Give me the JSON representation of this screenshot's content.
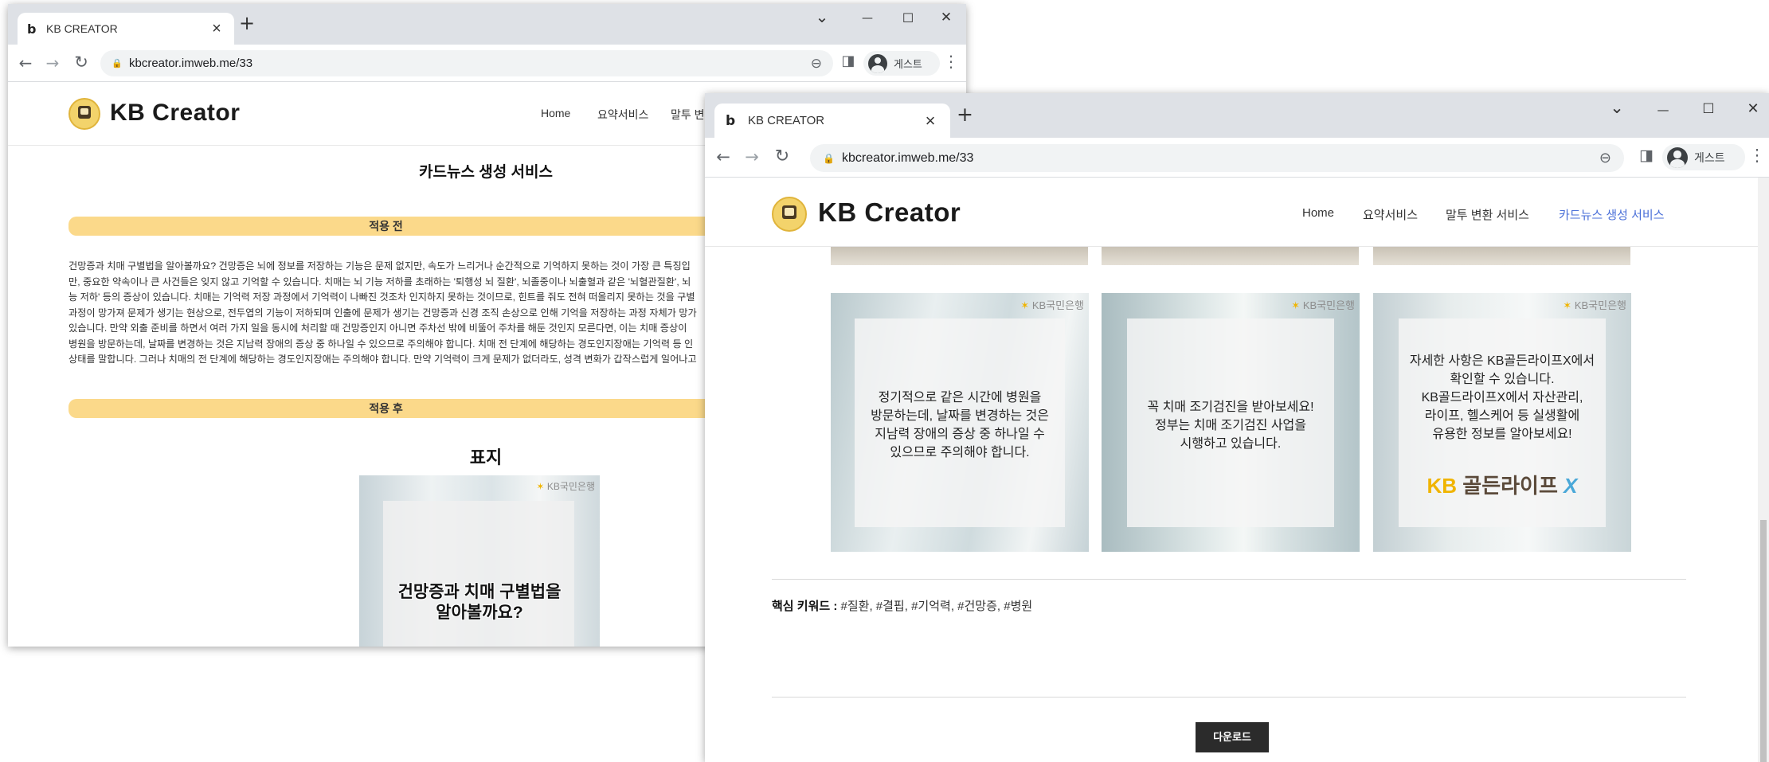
{
  "back_window": {
    "tab_title": "KB CREATOR",
    "favicon": "b",
    "url": "kbcreator.imweb.me/33",
    "profile_label": "게스트",
    "site": {
      "logo_text": "KB Creator",
      "nav": [
        "Home",
        "요약서비스",
        "말투 변환"
      ]
    },
    "page_title": "카드뉴스 생성 서비스",
    "before_label": "적용 전",
    "after_label": "적용 후",
    "paragraph_lines": [
      "건망증과 치매 구별법을 알아볼까요? 건망증은 뇌에 정보를 저장하는 기능은 문제 없지만, 속도가 느리거나 순간적으로 기억하지 못하는 것이 가장 큰 특징입",
      "만, 중요한 약속이나 큰 사건들은 잊지 않고 기억할 수 있습니다. 치매는 뇌 기능 저하를 초래하는 '퇴행성 뇌 질환', 뇌졸중이나 뇌출혈과 같은 '뇌혈관질환', 뇌",
      "능 저하' 등의 증상이 있습니다. 치매는 기억력 저장 과정에서 기억력이 나빠진 것조차 인지하지 못하는 것이므로, 힌트를 줘도 전혀 떠올리지 못하는 것을 구별",
      "과정이 망가져 문제가 생기는 현상으로, 전두엽의 기능이 저하되며 인출에 문제가 생기는 건망증과 신경 조직 손상으로 인해 기억을 저장하는 과정 자체가 망가",
      "있습니다. 만약 외출 준비를 하면서 여러 가지 일을 동시에 처리할 때 건망증인지 아니면 주차선 밖에 비뚤어 주차를 해둔 것인지 모른다면, 이는 치매 증상이 ",
      "병원을 방문하는데, 날짜를 변경하는 것은 지남력 장애의 증상 중 하나일 수 있으므로 주의해야 합니다. 치매 전 단계에 해당하는 경도인지장애는 기억력 등 인",
      "상태를 말합니다. 그러나 치매의 전 단계에 해당하는 경도인지장애는 주의해야 합니다. 만약 기억력이 크게 문제가 없더라도, 성격 변화가 갑작스럽게 일어나고"
    ],
    "cover_heading": "표지",
    "cover_text_line1": "건망증과 치매 구별법을",
    "cover_text_line2": "알아볼까요?",
    "kb_mark": "KB국민은행"
  },
  "front_window": {
    "tab_title": "KB CREATOR",
    "favicon": "b",
    "url": "kbcreator.imweb.me/33",
    "profile_label": "게스트",
    "site": {
      "logo_text": "KB Creator",
      "nav": [
        "Home",
        "요약서비스",
        "말투 변환 서비스",
        "카드뉴스 생성 서비스"
      ],
      "active_index": 3
    },
    "kb_mark": "KB국민은행",
    "cards": [
      {
        "lines": [
          "정기적으로 같은 시간에 병원을",
          "방문하는데, 날짜를 변경하는 것은",
          "지남력 장애의 증상 중 하나일 수",
          "있으므로 주의해야 합니다."
        ]
      },
      {
        "lines": [
          "꼭 치매 조기검진을 받아보세요!",
          "정부는 치매 조기검진 사업을",
          "시행하고 있습니다."
        ]
      },
      {
        "lines": [
          "자세한 사항은 KB골든라이프X에서",
          "확인할 수 있습니다.",
          "KB골드라이프X에서 자산관리,",
          "라이프, 헬스케어 등 실생활에",
          "유용한 정보를 알아보세요!"
        ],
        "logo": {
          "kb": "KB",
          "name": "골든라이프",
          "x": "X"
        }
      }
    ],
    "keywords_label": "핵심 키워드 :",
    "keywords": "#질환, #결핍, #기억력, #건망증, #병원",
    "download_label": "다운로드"
  },
  "icons": {
    "back": "←",
    "forward": "→",
    "reload": "↻",
    "lock": "🔒",
    "zoom": "⊖",
    "sidepanel": "◨",
    "menu": "⋮",
    "minimize": "—",
    "maximize": "☐",
    "close": "✕",
    "chevron": "⌄",
    "newtab": "+",
    "tabclose": "×"
  }
}
